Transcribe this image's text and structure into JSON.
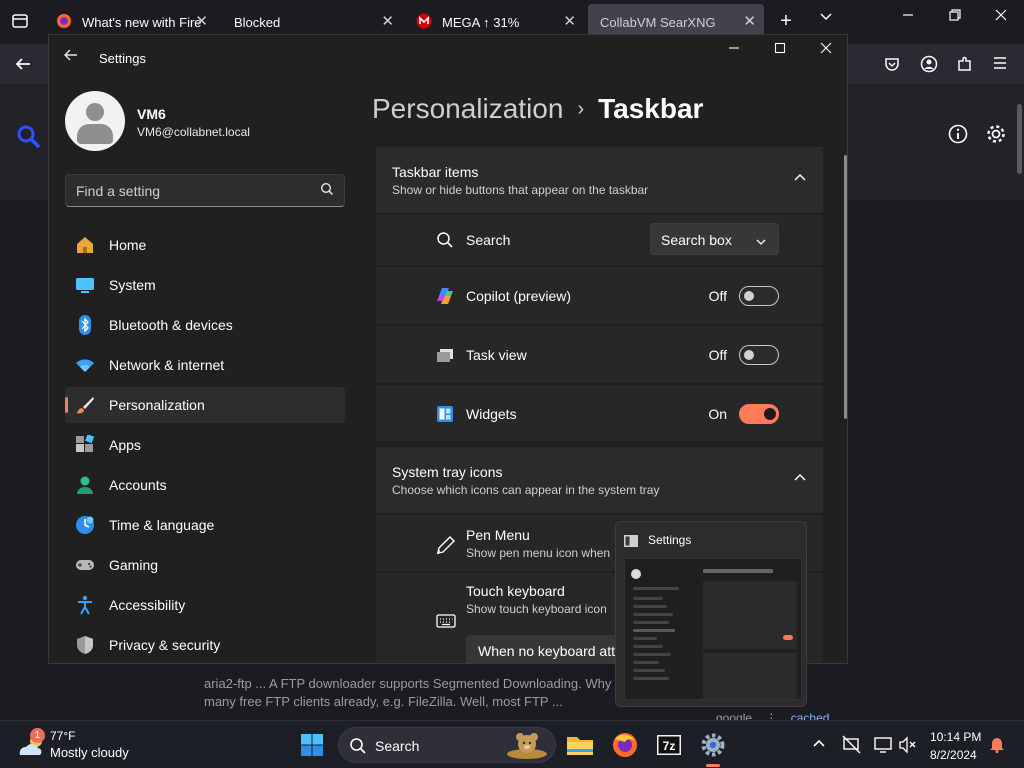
{
  "firefox": {
    "tabs": [
      {
        "label": "What's new with Firefox"
      },
      {
        "label": "Blocked"
      },
      {
        "label": "MEGA ↑ 31%"
      },
      {
        "label": "CollabVM SearXNG"
      }
    ],
    "tab_close_glyph": "✕",
    "new_tab_glyph": "+",
    "list_tabs_glyph": "⌄",
    "snippet": {
      "heading_fragment": "aria2-ftp",
      "line1": "aria2-ftp ... A FTP downloader supports Segmented Downloading. Why",
      "line2": "many free FTP clients already, e.g. FileZilla. Well, most FTP ..."
    },
    "result_links": {
      "google": "google",
      "sep": "⋮",
      "cached": "cached"
    }
  },
  "settings": {
    "title": "Settings",
    "profile": {
      "name": "VM6",
      "email": "VM6@collabnet.local"
    },
    "search_placeholder": "Find a setting",
    "nav": [
      {
        "label": "Home",
        "icon": "home-icon"
      },
      {
        "label": "System",
        "icon": "system-icon"
      },
      {
        "label": "Bluetooth & devices",
        "icon": "bluetooth-icon"
      },
      {
        "label": "Network & internet",
        "icon": "network-icon"
      },
      {
        "label": "Personalization",
        "icon": "personalization-icon",
        "selected": true
      },
      {
        "label": "Apps",
        "icon": "apps-icon"
      },
      {
        "label": "Accounts",
        "icon": "accounts-icon"
      },
      {
        "label": "Time & language",
        "icon": "time-language-icon"
      },
      {
        "label": "Gaming",
        "icon": "gaming-icon"
      },
      {
        "label": "Accessibility",
        "icon": "accessibility-icon"
      },
      {
        "label": "Privacy & security",
        "icon": "privacy-icon"
      }
    ],
    "breadcrumb": {
      "parent": "Personalization",
      "sep": "›",
      "current": "Taskbar"
    },
    "taskbar_items": {
      "title": "Taskbar items",
      "subtitle": "Show or hide buttons that appear on the taskbar",
      "rows": [
        {
          "label": "Search",
          "control": "dropdown",
          "value": "Search box"
        },
        {
          "label": "Copilot (preview)",
          "control": "toggle",
          "state": "Off",
          "on": false
        },
        {
          "label": "Task view",
          "control": "toggle",
          "state": "Off",
          "on": false
        },
        {
          "label": "Widgets",
          "control": "toggle",
          "state": "On",
          "on": true
        }
      ]
    },
    "system_tray": {
      "title": "System tray icons",
      "subtitle": "Choose which icons can appear in the system tray",
      "pen": {
        "label": "Pen Menu",
        "sub": "Show pen menu icon when"
      },
      "keyboard": {
        "label": "Touch keyboard",
        "sub": "Show touch keyboard icon",
        "dropdown": "When no keyboard att"
      }
    },
    "accent": "#ff7a59"
  },
  "thumbnail": {
    "title": "Settings"
  },
  "taskbar": {
    "weather": {
      "badge": "1",
      "temp": "77°F",
      "desc": "Mostly cloudy"
    },
    "search_label": "Search",
    "clock": {
      "time": "10:14 PM",
      "date": "8/2/2024"
    }
  }
}
